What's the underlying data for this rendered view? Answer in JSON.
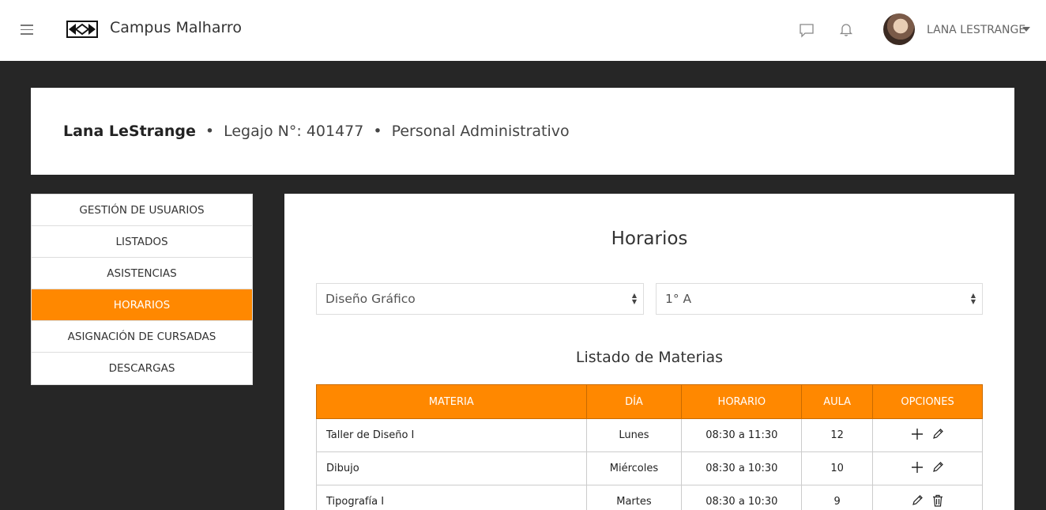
{
  "header": {
    "brand": "Campus Malharro",
    "user_name": "LANA LESTRANGE"
  },
  "profile": {
    "name": "Lana LeStrange",
    "legajo": "Legajo N°: 401477",
    "role": "Personal Administrativo"
  },
  "sidebar": {
    "items": [
      {
        "label": "GESTIÓN DE USUARIOS"
      },
      {
        "label": "LISTADOS"
      },
      {
        "label": "ASISTENCIAS"
      },
      {
        "label": "HORARIOS",
        "active": true
      },
      {
        "label": "ASIGNACIÓN DE CURSADAS"
      },
      {
        "label": "DESCARGAS"
      }
    ]
  },
  "main": {
    "title": "Horarios",
    "career_select": {
      "value": "Diseño Gráfico"
    },
    "year_select": {
      "value": "1° A"
    },
    "list_title": "Listado de Materias",
    "table": {
      "headers": [
        "MATERIA",
        "DÍA",
        "HORARIO",
        "AULA",
        "OPCIONES"
      ],
      "rows": [
        {
          "materia": "Taller de Diseño I",
          "dia": "Lunes",
          "horario": "08:30 a 11:30",
          "aula": "12",
          "options": [
            "add-icon",
            "edit-icon"
          ]
        },
        {
          "materia": "Dibujo",
          "dia": "Miércoles",
          "horario": "08:30 a 10:30",
          "aula": "10",
          "options": [
            "add-icon",
            "edit-icon"
          ]
        },
        {
          "materia": "Tipografía I",
          "dia": "Martes",
          "horario": "08:30 a 10:30",
          "aula": "9",
          "options": [
            "edit-icon",
            "trash-icon"
          ]
        }
      ]
    }
  },
  "colors": {
    "accent": "#ff8800",
    "background": "#262626"
  }
}
